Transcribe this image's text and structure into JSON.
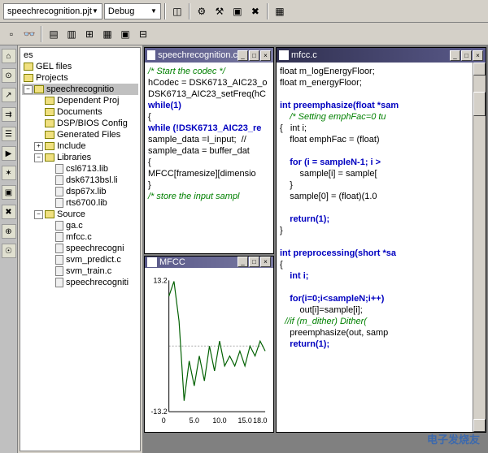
{
  "toolbar": {
    "project_dropdown": "speechrecognition.pjt",
    "config_dropdown": "Debug"
  },
  "sidebar": {
    "top_items": [
      "es",
      "GEL files",
      "Projects"
    ],
    "project": "speechrecognitio",
    "folders": {
      "dep": "Dependent Proj",
      "doc": "Documents",
      "dsp": "DSP/BIOS Config",
      "gen": "Generated Files",
      "inc": "Include",
      "lib": "Libraries",
      "src": "Source"
    },
    "libs": [
      "csl6713.lib",
      "dsk6713bsl.li",
      "dsp67x.lib",
      "rts6700.lib"
    ],
    "srcs": [
      "ga.c",
      "mfcc.c",
      "speechrecogni",
      "svm_predict.c",
      "svm_train.c",
      "speechrecogniti"
    ]
  },
  "editor1": {
    "title": "speechrecognition.c",
    "lines": [
      {
        "cls": "comment",
        "t": "/* Start the codec */"
      },
      {
        "cls": "",
        "t": "hCodec = DSK6713_AIC23_o"
      },
      {
        "cls": "",
        "t": "DSK6713_AIC23_setFreq(hC"
      },
      {
        "cls": "keyword",
        "t": "while(1)"
      },
      {
        "cls": "",
        "t": "{"
      },
      {
        "cls": "keyword",
        "t": "while (!DSK6713_AIC23_re"
      },
      {
        "cls": "",
        "t": "sample_data =I_input;  //"
      },
      {
        "cls": "",
        "t": "sample_data = buffer_dat"
      },
      {
        "cls": "",
        "t": "{"
      },
      {
        "cls": "",
        "t": "MFCC[framesize][dimensio"
      },
      {
        "cls": "",
        "t": "}"
      },
      {
        "cls": "comment",
        "t": "/* store the input sampl"
      }
    ]
  },
  "editor2": {
    "title": "mfcc.c",
    "lines": [
      {
        "cls": "",
        "t": "float m_logEnergyFloor;"
      },
      {
        "cls": "",
        "t": "float m_energyFloor;"
      },
      {
        "cls": "",
        "t": ""
      },
      {
        "cls": "keyword",
        "t": "int preemphasize(float *sam"
      },
      {
        "cls": "comment",
        "t": "    /* Setting emphFac=0 tu"
      },
      {
        "cls": "",
        "t": "{   int i;"
      },
      {
        "cls": "",
        "t": "    float emphFac = (float)"
      },
      {
        "cls": "",
        "t": ""
      },
      {
        "cls": "keyword",
        "t": "    for (i = sampleN-1; i >"
      },
      {
        "cls": "",
        "t": "        sample[i] = sample["
      },
      {
        "cls": "",
        "t": "    }"
      },
      {
        "cls": "",
        "t": "    sample[0] = (float)(1.0"
      },
      {
        "cls": "",
        "t": ""
      },
      {
        "cls": "keyword",
        "t": "    return(1);"
      },
      {
        "cls": "",
        "t": "}"
      },
      {
        "cls": "",
        "t": ""
      },
      {
        "cls": "keyword",
        "t": "int preprocessing(short *sa"
      },
      {
        "cls": "",
        "t": "{"
      },
      {
        "cls": "keyword",
        "t": "    int i;"
      },
      {
        "cls": "",
        "t": ""
      },
      {
        "cls": "keyword",
        "t": "    for(i=0;i<sampleN;i++)"
      },
      {
        "cls": "",
        "t": "        out[i]=sample[i];"
      },
      {
        "cls": "comment",
        "t": "  //if (m_dither) Dither("
      },
      {
        "cls": "",
        "t": "    preemphasize(out, samp"
      },
      {
        "cls": "keyword",
        "t": "    return(1);"
      }
    ]
  },
  "chart_window": {
    "title": "MFCC"
  },
  "chart_data": {
    "type": "line",
    "x": [
      0,
      1,
      2,
      3,
      4,
      5,
      6,
      7,
      8,
      9,
      10,
      11,
      12,
      13,
      14,
      15,
      16,
      17,
      18,
      19
    ],
    "values": [
      10,
      13,
      5,
      -11,
      -3,
      -8,
      -2,
      -7,
      0,
      -5,
      1,
      -4,
      -2,
      -4,
      -1,
      -4,
      0,
      -2,
      1,
      -1
    ],
    "ylim": [
      -13.2,
      13.2
    ],
    "xlim": [
      0,
      19
    ],
    "xticks": [
      5.0,
      10.0,
      15.0,
      18.0
    ],
    "yticks": [
      13.2,
      -13.2
    ]
  },
  "watermark": "电子发烧友"
}
